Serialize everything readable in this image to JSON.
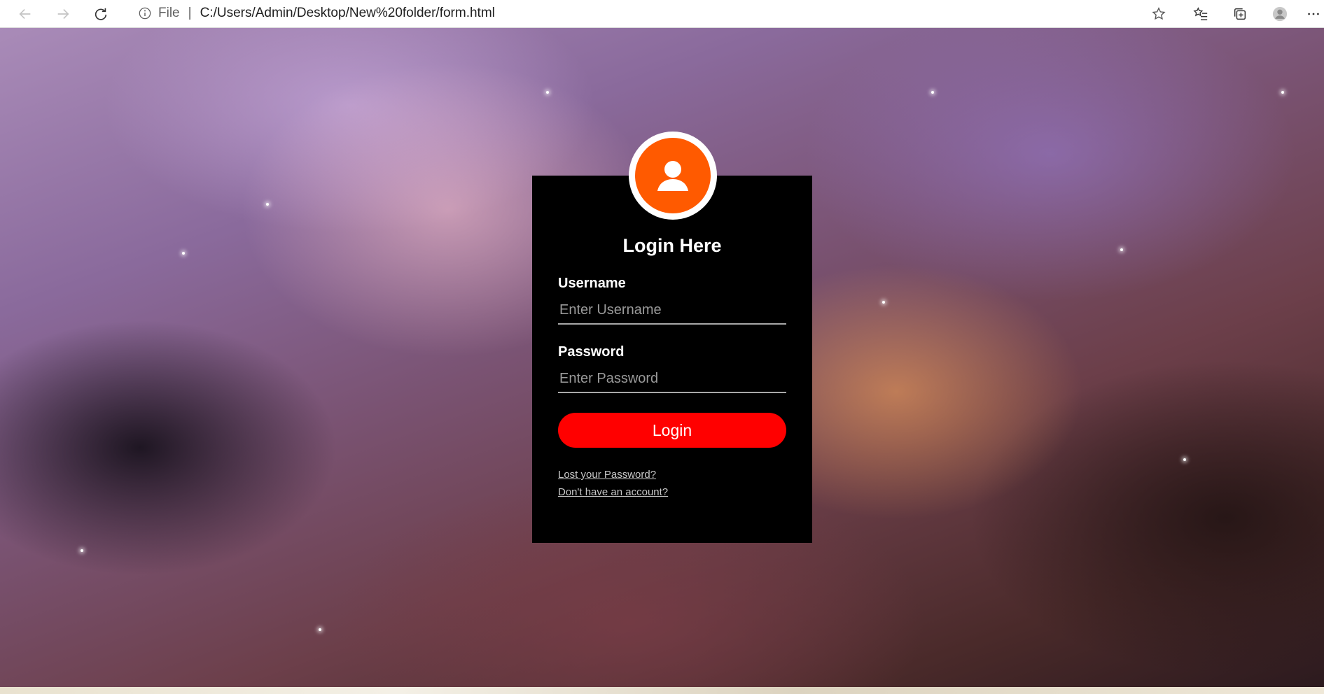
{
  "browser": {
    "back_icon": "arrow-left-icon",
    "forward_icon": "arrow-right-icon",
    "refresh_icon": "refresh-icon",
    "site_label": "File",
    "separator": "|",
    "url": "C:/Users/Admin/Desktop/New%20folder/form.html",
    "right_icons": [
      "star-icon",
      "favorites-icon",
      "collections-icon",
      "profile-icon",
      "more-icon"
    ]
  },
  "login_card": {
    "avatar_icon": "user-icon",
    "title": "Login Here",
    "username_label": "Username",
    "username_placeholder": "Enter Username",
    "password_label": "Password",
    "password_placeholder": "Enter Password",
    "submit_label": "Login",
    "lost_password_link": "Lost your Password?",
    "signup_link": "Don't have an account?"
  },
  "colors": {
    "card_background": "#000000",
    "avatar_accent": "#ff5a00",
    "button": "#ff0000"
  }
}
